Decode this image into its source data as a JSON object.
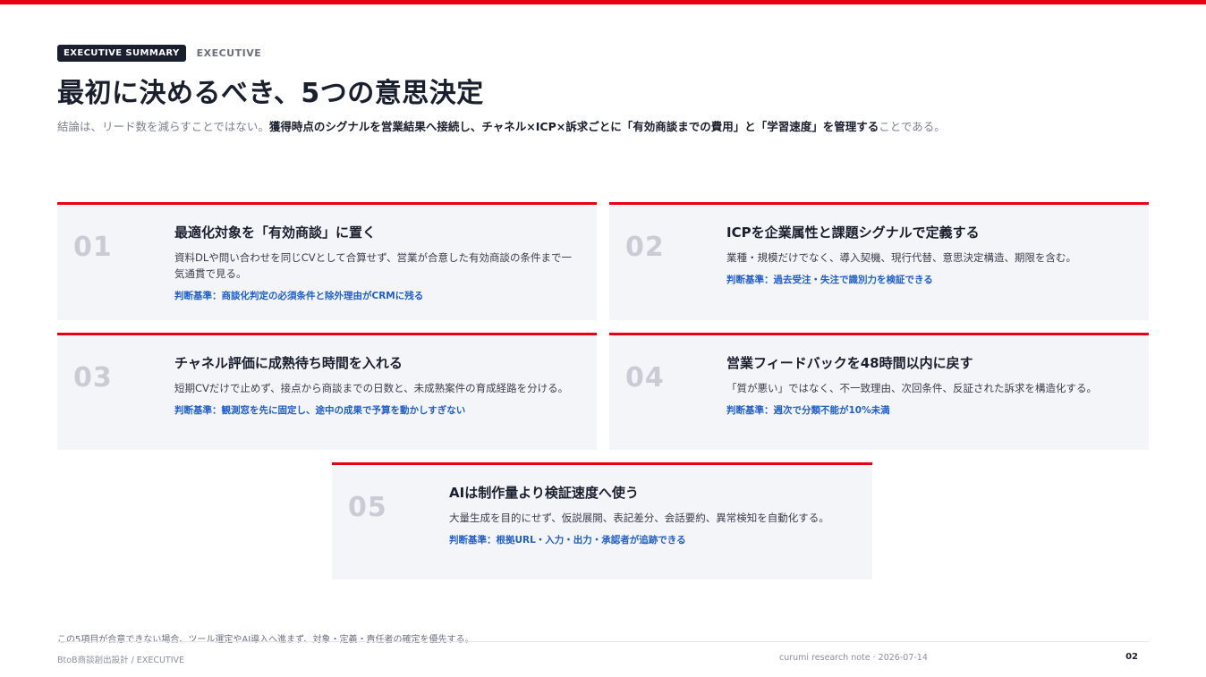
{
  "header": {
    "tag": "EXECUTIVE SUMMARY",
    "tag_sub": "EXECUTIVE",
    "title": "最初に決めるべき、5つの意思決定",
    "lead_pre": "結論は、リード数を減らすことではない。",
    "lead_strong": "獲得時点のシグナルを営業結果へ接続し、チャネル×ICP×訴求ごとに「有効商談までの費用」と「学習速度」を管理する",
    "lead_post": "ことである。"
  },
  "cards": [
    {
      "num": "01",
      "title": "最適化対象を「有効商談」に置く",
      "desc": "資料DLや問い合わせを同じCVとして合算せず、営業が合意した有効商談の条件まで一気通貫で見る。",
      "criterion": "判断基準：商談化判定の必須条件と除外理由がCRMに残る"
    },
    {
      "num": "02",
      "title": "ICPを企業属性と課題シグナルで定義する",
      "desc": "業種・規模だけでなく、導入契機、現行代替、意思決定構造、期限を含む。",
      "criterion": "判断基準：過去受注・失注で識別力を検証できる"
    },
    {
      "num": "03",
      "title": "チャネル評価に成熟待ち時間を入れる",
      "desc": "短期CVだけで止めず、接点から商談までの日数と、未成熟案件の育成経路を分ける。",
      "criterion": "判断基準：観測窓を先に固定し、途中の成果で予算を動かしすぎない"
    },
    {
      "num": "04",
      "title": "営業フィードバックを48時間以内に戻す",
      "desc": "「質が悪い」ではなく、不一致理由、次回条件、反証された訴求を構造化する。",
      "criterion": "判断基準：週次で分類不能が10%未満"
    },
    {
      "num": "05",
      "title": "AIは制作量より検証速度へ使う",
      "desc": "大量生成を目的にせず、仮説展開、表記差分、会話要約、異常検知を自動化する。",
      "criterion": "判断基準：根拠URL・入力・出力・承認者が追跡できる"
    }
  ],
  "note": "この5項目が合意できない場合、ツール選定やAI導入へ進まず、対象・定義・責任者の確定を優先する。",
  "footer": {
    "left": "BtoB商談創出設計 / EXECUTIVE",
    "center": "curumi research note · 2026-07-14",
    "page": "02"
  },
  "colors": {
    "accent": "#e60012",
    "criterion": "#1f5fc9",
    "card_bg": "#f4f5f8"
  }
}
